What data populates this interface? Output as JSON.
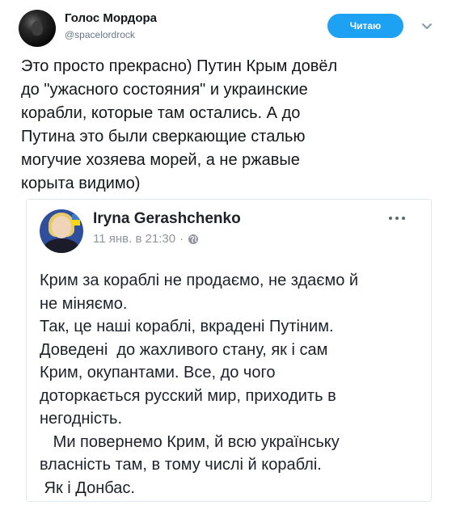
{
  "tweet": {
    "display_name": "Голос Мордора",
    "handle": "@spacelordrock",
    "follow_label": "Читаю",
    "text_lines": [
      "Это просто прекрасно) Путин Крым довёл",
      "до \"ужасного состояния\" и украинские",
      "корабли, которые там остались. А до",
      "Путина это были сверкающие сталью",
      "могучие хозяева морей, а не ржавые",
      "корыта видимо)"
    ]
  },
  "embedded_post": {
    "author": "Iryna Gerashchenko",
    "timestamp": "11 янв. в 21:30",
    "separator": "·",
    "text_lines": [
      "Крим за кораблі не продаємо, не здаємо й",
      "не міняємо.",
      "Так, це наші кораблі, вкрадені Путіним.",
      "Доведені  до жахливого стану, як і сам",
      "Крим, окупантами. Все, до чого",
      "доторкається русский мир, приходить в",
      "негодність.",
      "   Ми повернемо Крим, й всю українську",
      "власність там, в тому числі й кораблі.",
      " Як і Донбас."
    ]
  },
  "icons": {
    "chevron": "chevron-down-icon",
    "globe": "globe-icon",
    "more": "more-options-icon"
  },
  "colors": {
    "accent": "#1da1f2",
    "secondary_text": "#657786",
    "fb_meta": "#90949c"
  }
}
